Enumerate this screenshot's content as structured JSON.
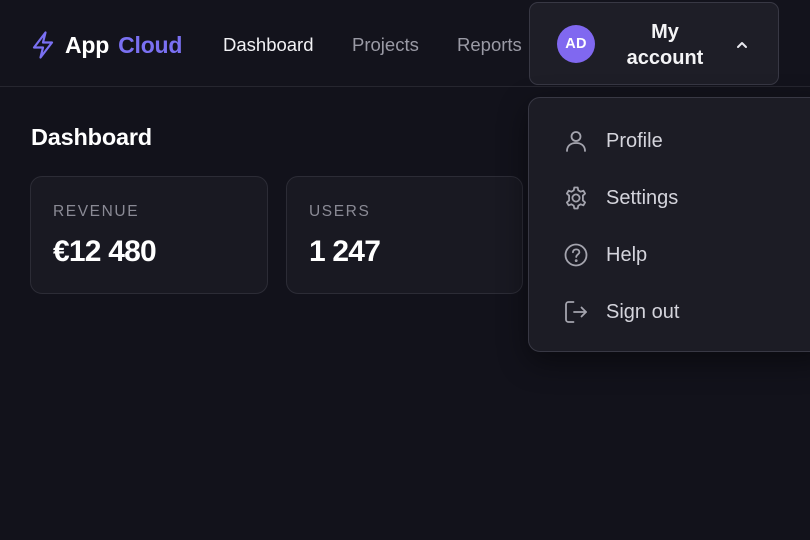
{
  "header": {
    "logo": {
      "icon": "lightning-bolt-icon",
      "app_text": "App",
      "cloud_text": "Cloud"
    },
    "nav": [
      {
        "label": "Dashboard",
        "active": true
      },
      {
        "label": "Projects",
        "active": false
      },
      {
        "label": "Reports",
        "active": false
      }
    ],
    "account": {
      "initials": "AD",
      "label": "My account",
      "expanded": true,
      "chevron_icon": "chevron-up-icon"
    }
  },
  "main": {
    "title": "Dashboard",
    "stats": [
      {
        "label": "REVENUE",
        "value": "€12 480"
      },
      {
        "label": "USERS",
        "value": "1 247"
      }
    ]
  },
  "account_menu": {
    "items": [
      {
        "label": "Profile",
        "icon": "user-icon"
      },
      {
        "label": "Settings",
        "icon": "gear-icon"
      },
      {
        "label": "Help",
        "icon": "help-circle-icon"
      },
      {
        "label": "Sign out",
        "icon": "sign-out-icon"
      }
    ]
  },
  "colors": {
    "background": "#12121b",
    "accent": "#7a70f2",
    "avatar": "#8068f0",
    "surface": "#1c1c25",
    "border": "#383844",
    "muted_text": "#9a9aa5"
  }
}
